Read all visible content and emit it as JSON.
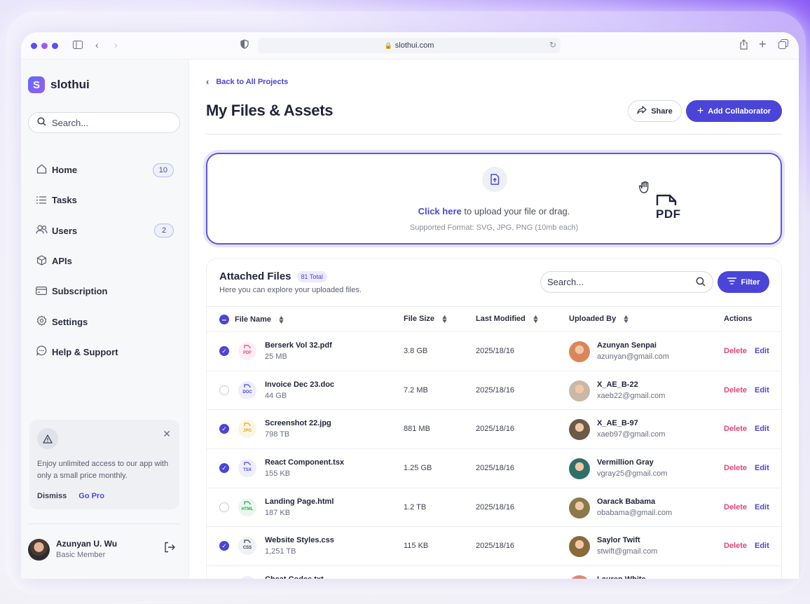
{
  "browser": {
    "url": "slothui.com",
    "dots": [
      "#5b4ef5",
      "#9a5cf5",
      "#5b4ef5"
    ]
  },
  "sidebar": {
    "logo_text": "slothui",
    "logo_letter": "S",
    "search_placeholder": "Search...",
    "items": [
      {
        "label": "Home",
        "icon": "home-icon",
        "badge": "10"
      },
      {
        "label": "Tasks",
        "icon": "list-icon",
        "badge": null
      },
      {
        "label": "Users",
        "icon": "users-icon",
        "badge": "2"
      },
      {
        "label": "APIs",
        "icon": "cube-icon",
        "badge": null
      },
      {
        "label": "Subscription",
        "icon": "card-icon",
        "badge": null
      },
      {
        "label": "Settings",
        "icon": "gear-icon",
        "badge": null
      },
      {
        "label": "Help & Support",
        "icon": "chat-icon",
        "badge": null
      }
    ],
    "promo": {
      "message": "Enjoy unlimited access to our app with only a small price monthly.",
      "dismiss": "Dismiss",
      "go_pro": "Go Pro"
    },
    "user": {
      "name": "Azunyan U. Wu",
      "role": "Basic Member"
    }
  },
  "main": {
    "back_label": "Back to All Projects",
    "title": "My Files & Assets",
    "share_label": "Share",
    "add_collab_label": "Add Collaborator",
    "upload": {
      "link": "Click here",
      "text": " to upload your file or drag.",
      "format": "Supported Format: SVG, JPG, PNG (10mb each)",
      "drag_label": "PDF"
    },
    "files": {
      "title": "Attached Files",
      "count": "81 Total",
      "subtitle": "Here you can explore your uploaded files.",
      "search_placeholder": "Search...",
      "filter_label": "Filter",
      "columns": [
        "File Name",
        "File Size",
        "Last Modified",
        "Uploaded By",
        "Actions"
      ],
      "delete_label": "Delete",
      "edit_label": "Edit",
      "rows": [
        {
          "checked": true,
          "type": "PDF",
          "type_color": "#e0457b",
          "type_bg": "#fdeef3",
          "name": "Berserk Vol 32.pdf",
          "size_sub": "25 MB",
          "size": "3.8 GB",
          "modified": "2025/18/16",
          "user": "Azunyan Senpai",
          "email": "azunyan@gmail.com",
          "avatar_color": "#d9875a"
        },
        {
          "checked": false,
          "type": "DOC",
          "type_color": "#4a45d8",
          "type_bg": "#eeeefc",
          "name": "Invoice Dec 23.doc",
          "size_sub": "44 GB",
          "size": "7.2 MB",
          "modified": "2025/18/16",
          "user": "X_AE_B-22",
          "email": "xaeb22@gmail.com",
          "avatar_color": "#c9b8a8"
        },
        {
          "checked": true,
          "type": "JPG",
          "type_color": "#e3a31e",
          "type_bg": "#fdf5e4",
          "name": "Screenshot 22.jpg",
          "size_sub": "798 TB",
          "size": "881 MB",
          "modified": "2025/18/16",
          "user": "X_AE_B-97",
          "email": "xaeb97@gmail.com",
          "avatar_color": "#6b5a48"
        },
        {
          "checked": true,
          "type": "TSX",
          "type_color": "#4a45d8",
          "type_bg": "#eeeefc",
          "name": "React Component.tsx",
          "size_sub": "155 KB",
          "size": "1.25 GB",
          "modified": "2025/18/16",
          "user": "Vermillion Gray",
          "email": "vgray25@gmail.com",
          "avatar_color": "#2f6f6a"
        },
        {
          "checked": false,
          "type": "HTML",
          "type_color": "#2ea44f",
          "type_bg": "#e9f7ee",
          "name": "Landing Page.html",
          "size_sub": "187 KB",
          "size": "1.2 TB",
          "modified": "2025/18/16",
          "user": "Oarack Babama",
          "email": "obabama@gmail.com",
          "avatar_color": "#8a7a4a"
        },
        {
          "checked": true,
          "type": "CSS",
          "type_color": "#3a3e50",
          "type_bg": "#f0f1f4",
          "name": "Website Styles.css",
          "size_sub": "1,251 TB",
          "size": "115 KB",
          "modified": "2025/18/16",
          "user": "Saylor Twift",
          "email": "stwift@gmail.com",
          "avatar_color": "#8a6a3a"
        },
        {
          "checked": false,
          "type": "TXT",
          "type_color": "#4a45d8",
          "type_bg": "#eeeefc",
          "name": "Cheat Codes.txt",
          "size_sub": "",
          "size": "",
          "modified": "",
          "user": "Lauren White",
          "email": "",
          "avatar_color": "#d98a7a"
        }
      ]
    }
  }
}
